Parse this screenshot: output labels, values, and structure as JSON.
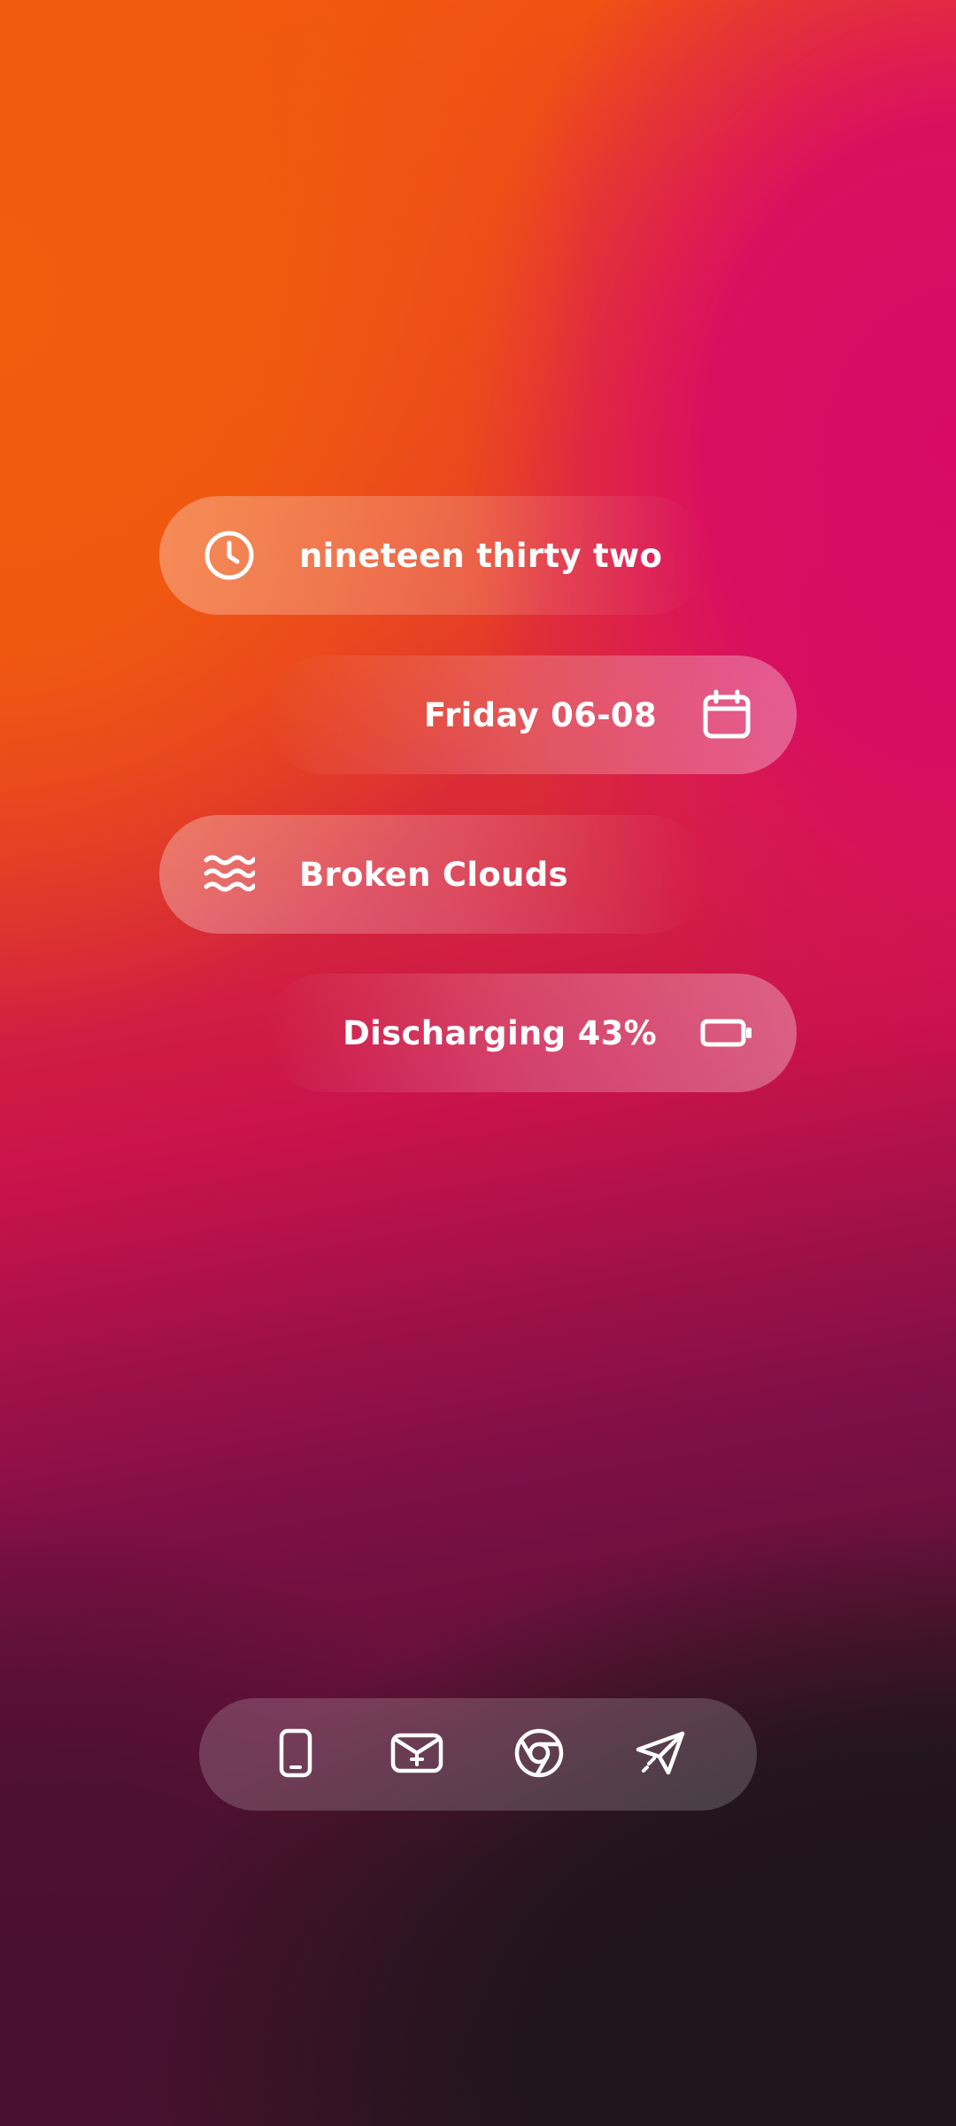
{
  "widgets": {
    "time": {
      "text": "nineteen thirty two",
      "icon": "clock-icon"
    },
    "date": {
      "text": "Friday 06-08",
      "icon": "calendar-icon"
    },
    "weather": {
      "text": "Broken Clouds",
      "icon": "waves-icon"
    },
    "battery": {
      "text": "Discharging 43%",
      "icon": "battery-icon",
      "level": 0.43
    }
  },
  "dock": {
    "apps": [
      {
        "name": "phone",
        "icon": "phone-icon"
      },
      {
        "name": "email",
        "icon": "email-icon"
      },
      {
        "name": "browser",
        "icon": "chrome-icon"
      },
      {
        "name": "messaging",
        "icon": "send-icon"
      }
    ]
  },
  "colors": {
    "orange": "#f25c0d",
    "magenta": "#d80a66",
    "dark": "#1f151a",
    "text": "#ffffff"
  }
}
